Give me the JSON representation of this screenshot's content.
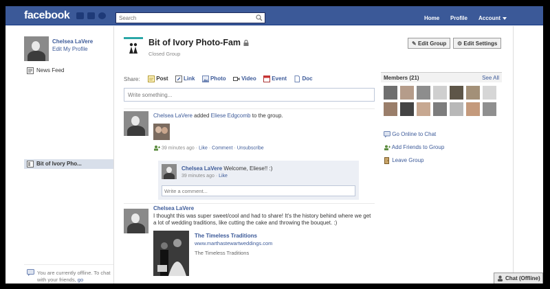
{
  "topbar": {
    "logo": "facebook",
    "search_placeholder": "Search",
    "nav": {
      "home": "Home",
      "profile": "Profile",
      "account": "Account"
    }
  },
  "left": {
    "user_name": "Chelsea LaVere",
    "edit_profile": "Edit My Profile",
    "news_feed": "News Feed",
    "group_item": "Bit of Ivory Pho...",
    "offline_prefix": "You are currently offline. To chat with your friends,",
    "offline_link": "go"
  },
  "group": {
    "name": "Bit of Ivory Photo-Fam",
    "type": "Closed Group",
    "edit_group": "Edit Group",
    "edit_settings": "Edit Settings"
  },
  "share": {
    "label": "Share:",
    "items": [
      "Post",
      "Link",
      "Photo",
      "Video",
      "Event",
      "Doc"
    ],
    "placeholder": "Write something..."
  },
  "story1": {
    "actor": "Chelsea LaVere",
    "verb": "added",
    "object": "Eliese Edgcomb",
    "suffix": "to the group.",
    "time": "39 minutes ago",
    "actions": [
      "Like",
      "Comment",
      "Unsubscribe"
    ],
    "comment": {
      "author": "Chelsea LaVere",
      "text": "Welcome, Eliese!! :)",
      "time": "39 minutes ago",
      "like": "Like"
    },
    "comment_placeholder": "Write a comment..."
  },
  "story2": {
    "author": "Chelsea LaVere",
    "text": "I thought this was super sweet/cool and had to share! It's the history behind where we get a lot of wedding traditions, like cutting the cake and throwing the bouquet. :)",
    "link_title": "The Timeless Traditions",
    "link_url": "www.marthastewartweddings.com",
    "link_desc": "The Timeless Traditions"
  },
  "right": {
    "members_label": "Members (21)",
    "see_all": "See All",
    "actions": [
      "Go Online to Chat",
      "Add Friends to Group",
      "Leave Group"
    ]
  },
  "chat": {
    "label": "Chat (Offline)"
  },
  "colors": {
    "brand": "#3b5998",
    "link": "#3b5998",
    "border": "#bdc7d8"
  }
}
